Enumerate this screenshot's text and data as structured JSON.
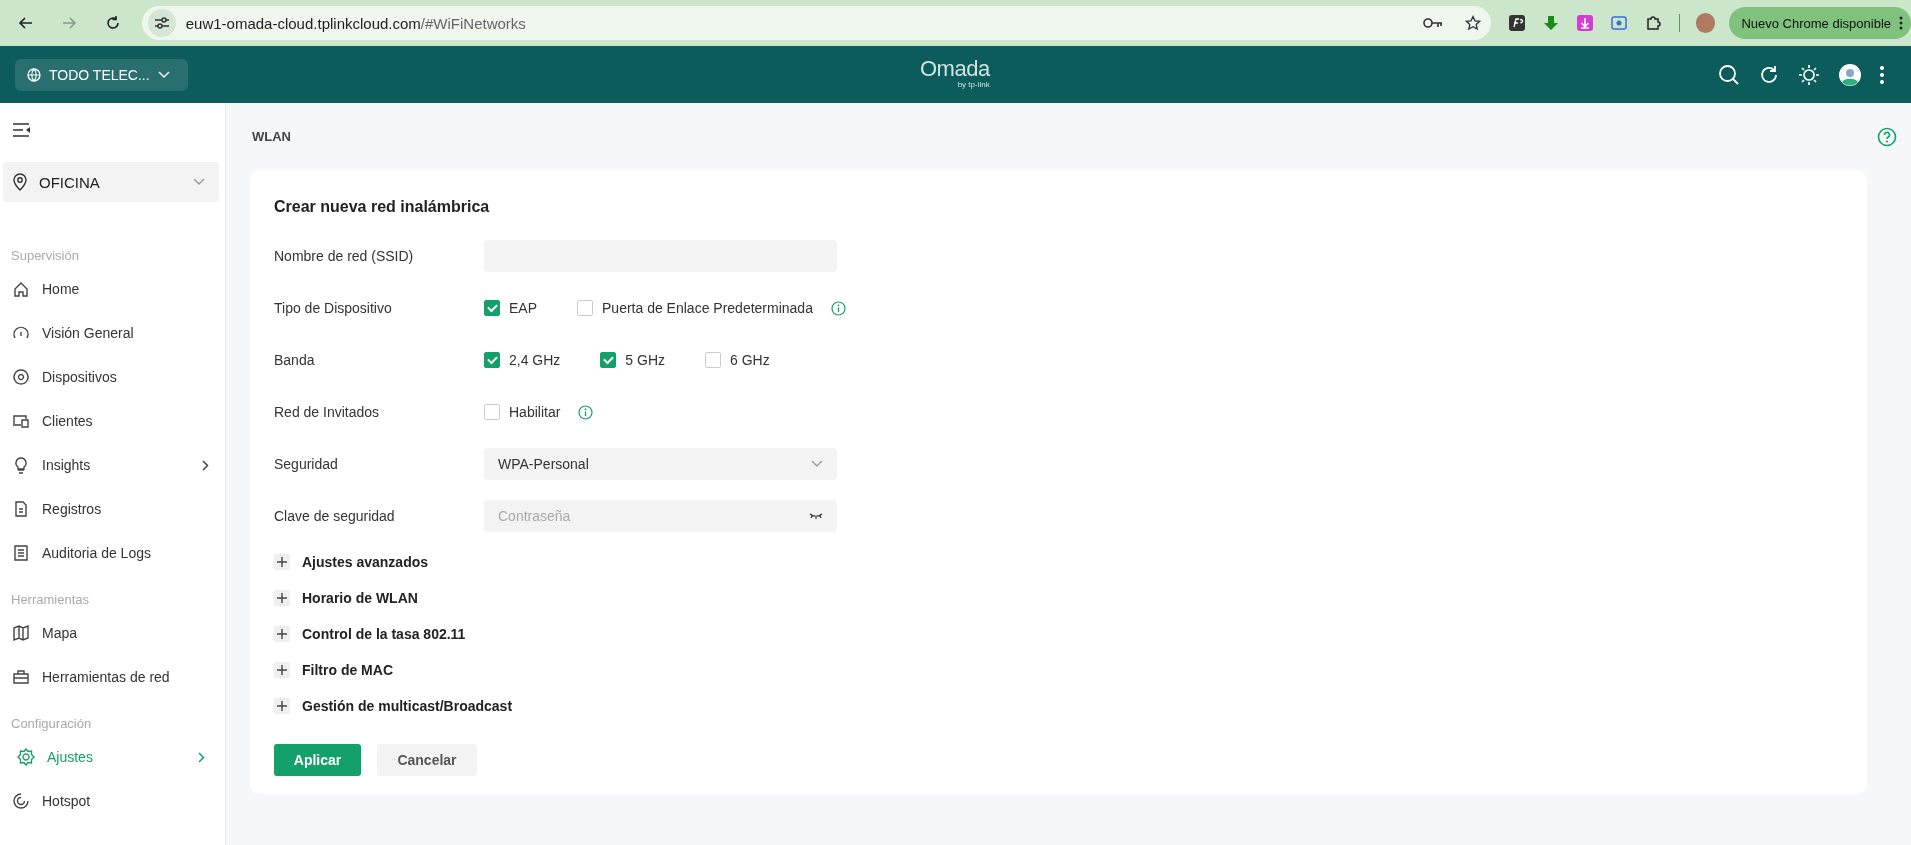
{
  "browser": {
    "url_host": "euw1-omada-cloud.tplinkcloud.com",
    "url_path": "/#WiFiNetworks",
    "update_button": "Nuevo Chrome disponible"
  },
  "header": {
    "org_selector": "TODO TELEC...",
    "logo": "Omada",
    "logo_sub": "by tp-link"
  },
  "sidebar": {
    "site": "OFICINA",
    "sections": [
      {
        "title": "Supervisión",
        "items": [
          {
            "label": "Home",
            "selected": false,
            "expandable": false
          },
          {
            "label": "Visión General",
            "selected": false,
            "expandable": false
          },
          {
            "label": "Dispositivos",
            "selected": false,
            "expandable": false
          },
          {
            "label": "Clientes",
            "selected": false,
            "expandable": false
          },
          {
            "label": "Insights",
            "selected": false,
            "expandable": true
          },
          {
            "label": "Registros",
            "selected": false,
            "expandable": false
          },
          {
            "label": "Auditoria de Logs",
            "selected": false,
            "expandable": false
          }
        ]
      },
      {
        "title": "Herramientas",
        "items": [
          {
            "label": "Mapa",
            "selected": false,
            "expandable": false
          },
          {
            "label": "Herramientas de red",
            "selected": false,
            "expandable": false
          }
        ]
      },
      {
        "title": "Configuración",
        "items": [
          {
            "label": "Ajustes",
            "selected": true,
            "expandable": true
          },
          {
            "label": "Hotspot",
            "selected": false,
            "expandable": false
          }
        ]
      }
    ]
  },
  "page": {
    "title": "WLAN"
  },
  "form": {
    "title": "Crear nueva red inalámbrica",
    "fields": [
      {
        "kind": "text",
        "label": "Nombre de red (SSID)"
      },
      {
        "kind": "checkboxes",
        "label": "Tipo de Dispositivo",
        "options": [
          {
            "label": "EAP",
            "checked": true,
            "info": false
          },
          {
            "label": "Puerta de Enlace Predeterminada",
            "checked": false,
            "info": true
          }
        ]
      },
      {
        "kind": "checkboxes",
        "label": "Banda",
        "options": [
          {
            "label": "2,4 GHz",
            "checked": true,
            "info": false
          },
          {
            "label": "5 GHz",
            "checked": true,
            "info": false
          },
          {
            "label": "6 GHz",
            "checked": false,
            "info": false
          }
        ]
      },
      {
        "kind": "checkboxes",
        "label": "Red de Invitados",
        "options": [
          {
            "label": "Habilitar",
            "checked": false,
            "info": true
          }
        ]
      },
      {
        "kind": "select",
        "label": "Seguridad",
        "value": "WPA-Personal"
      },
      {
        "kind": "password",
        "label": "Clave de seguridad",
        "placeholder": "Contraseña"
      }
    ],
    "sections": [
      {
        "label": "Ajustes avanzados",
        "expanded": false
      },
      {
        "label": "Horario de WLAN",
        "expanded": false
      },
      {
        "label": "Control de la tasa 802.11",
        "expanded": false
      },
      {
        "label": "Filtro de MAC",
        "expanded": false
      },
      {
        "label": "Gestión de multicast/Broadcast",
        "expanded": false
      }
    ],
    "buttons": [
      {
        "label": "Aplicar",
        "kind": "primary"
      },
      {
        "label": "Cancelar",
        "kind": "secondary"
      }
    ]
  }
}
